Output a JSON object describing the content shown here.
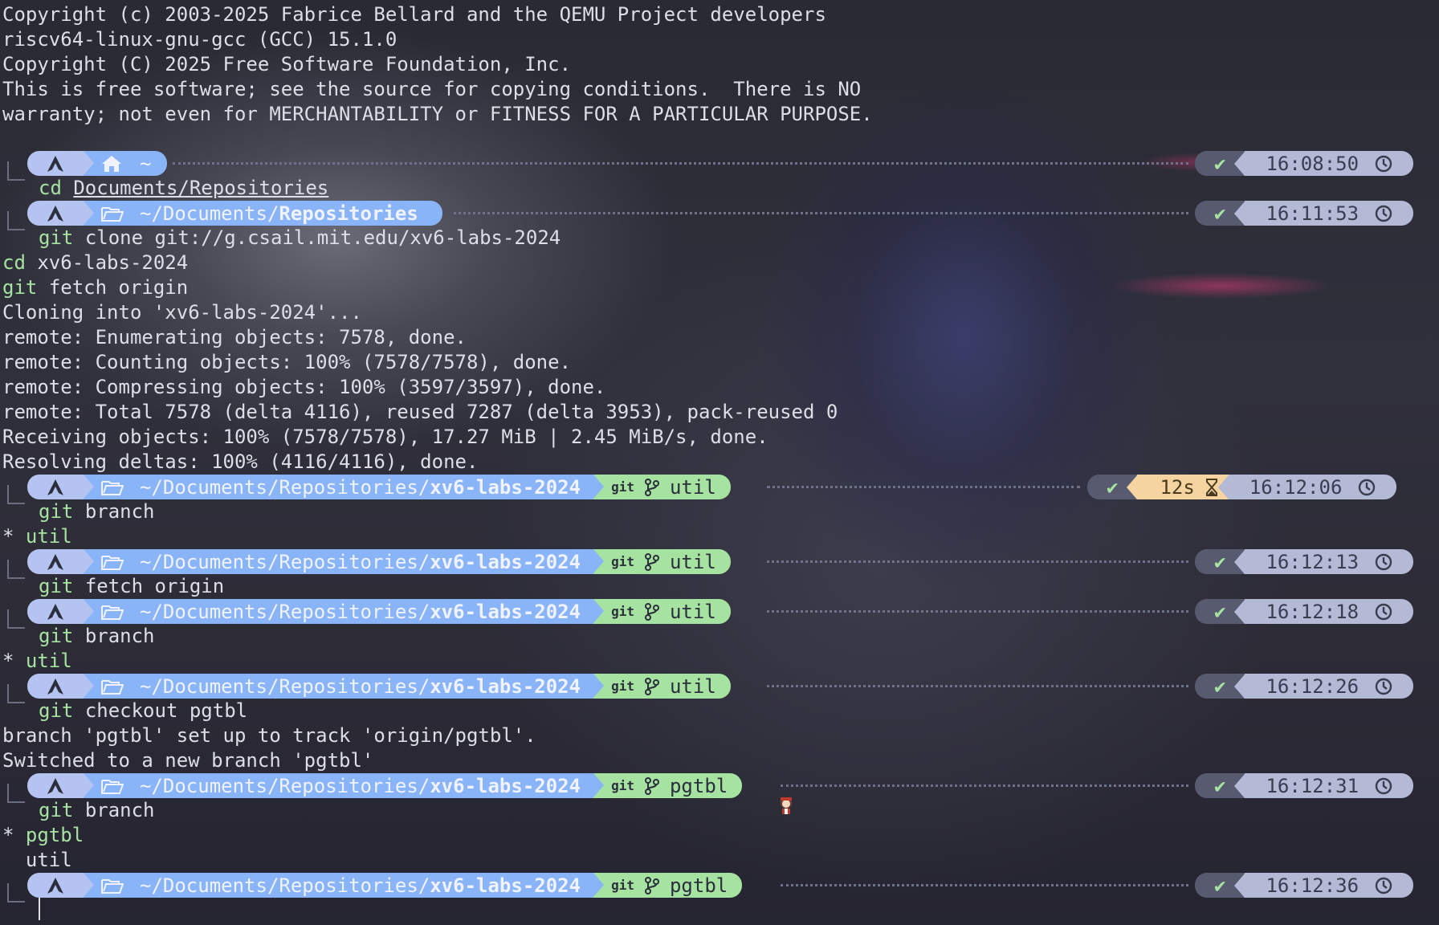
{
  "terminal": {
    "header_lines": [
      "Copyright (c) 2003-2025 Fabrice Bellard and the QEMU Project developers",
      "riscv64-linux-gnu-gcc (GCC) 15.1.0",
      "Copyright (C) 2025 Free Software Foundation, Inc.",
      "This is free software; see the source for copying conditions.  There is NO",
      "warranty; not even for MERCHANTABILITY or FITNESS FOR A PARTICULAR PURPOSE."
    ],
    "prompts": [
      {
        "dir": "~",
        "time": "16:08:50",
        "status": "✔"
      },
      {
        "dir_prefix": "~/Documents/",
        "dir_bold": "Repositories",
        "time": "16:11:53",
        "status": "✔"
      },
      {
        "dir_prefix": "~/Documents/Repositories/",
        "dir_bold": "xv6-labs-2024",
        "git": "git",
        "branch": "util",
        "duration": "12s",
        "time": "16:12:06",
        "status": "✔"
      },
      {
        "dir_prefix": "~/Documents/Repositories/",
        "dir_bold": "xv6-labs-2024",
        "git": "git",
        "branch": "util",
        "time": "16:12:13",
        "status": "✔"
      },
      {
        "dir_prefix": "~/Documents/Repositories/",
        "dir_bold": "xv6-labs-2024",
        "git": "git",
        "branch": "util",
        "time": "16:12:18",
        "status": "✔"
      },
      {
        "dir_prefix": "~/Documents/Repositories/",
        "dir_bold": "xv6-labs-2024",
        "git": "git",
        "branch": "util",
        "time": "16:12:26",
        "status": "✔"
      },
      {
        "dir_prefix": "~/Documents/Repositories/",
        "dir_bold": "xv6-labs-2024",
        "git": "git",
        "branch": "pgtbl",
        "time": "16:12:31",
        "status": "✔"
      },
      {
        "dir_prefix": "~/Documents/Repositories/",
        "dir_bold": "xv6-labs-2024",
        "git": "git",
        "branch": "pgtbl",
        "time": "16:12:36",
        "status": "✔"
      }
    ],
    "commands": {
      "c1_kw": "cd",
      "c1_arg": "Documents/Repositories",
      "c2_kw": "git",
      "c2_arg": "clone git://g.csail.mit.edu/xv6-labs-2024",
      "c2b_kw": "cd",
      "c2b_arg": "xv6-labs-2024",
      "c2c_kw": "git",
      "c2c_arg": "fetch origin",
      "c3_kw": "git",
      "c3_arg": "branch",
      "c4_kw": "git",
      "c4_arg": "fetch origin",
      "c5_kw": "git",
      "c5_arg": "branch",
      "c6_kw": "git",
      "c6_arg": "checkout pgtbl",
      "c7_kw": "git",
      "c7_arg": "branch"
    },
    "output": {
      "clone": [
        "Cloning into 'xv6-labs-2024'...",
        "remote: Enumerating objects: 7578, done.",
        "remote: Counting objects: 100% (7578/7578), done.",
        "remote: Compressing objects: 100% (3597/3597), done.",
        "remote: Total 7578 (delta 4116), reused 7287 (delta 3953), pack-reused 0",
        "Receiving objects: 100% (7578/7578), 17.27 MiB | 2.45 MiB/s, done.",
        "Resolving deltas: 100% (4116/4116), done."
      ],
      "branch1_star": "*",
      "branch1_name": "util",
      "branch2_star": "*",
      "branch2_name": "util",
      "checkout": [
        "branch 'pgtbl' set up to track 'origin/pgtbl'.",
        "Switched to a new branch 'pgtbl'"
      ],
      "branch3_star": "*",
      "branch3_current": "pgtbl",
      "branch3_other": "util"
    }
  },
  "colors": {
    "accent_blue": "#8ab4f8",
    "accent_green": "#a6e3a1",
    "duration_bg": "#f5d4a0",
    "time_bg": "#b4b9d6"
  }
}
